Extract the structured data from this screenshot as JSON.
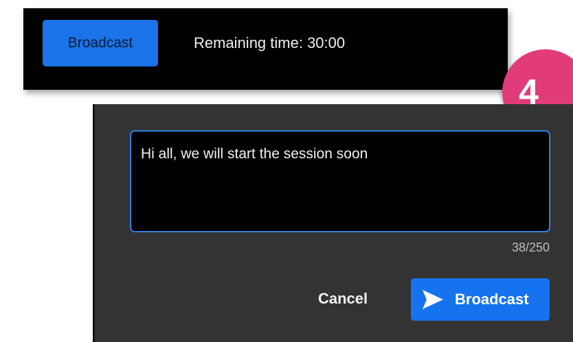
{
  "toolbar": {
    "broadcast_label": "Broadcast",
    "remaining_time": "Remaining time: 30:00"
  },
  "step_badge": {
    "number": "4",
    "color": "#e23b7a"
  },
  "dialog": {
    "message_value": "Hi all, we will start the session soon",
    "char_count": "38/250",
    "cancel_label": "Cancel",
    "send_label": "Broadcast",
    "send_icon": "send-icon",
    "accent_color": "#1673f0"
  }
}
